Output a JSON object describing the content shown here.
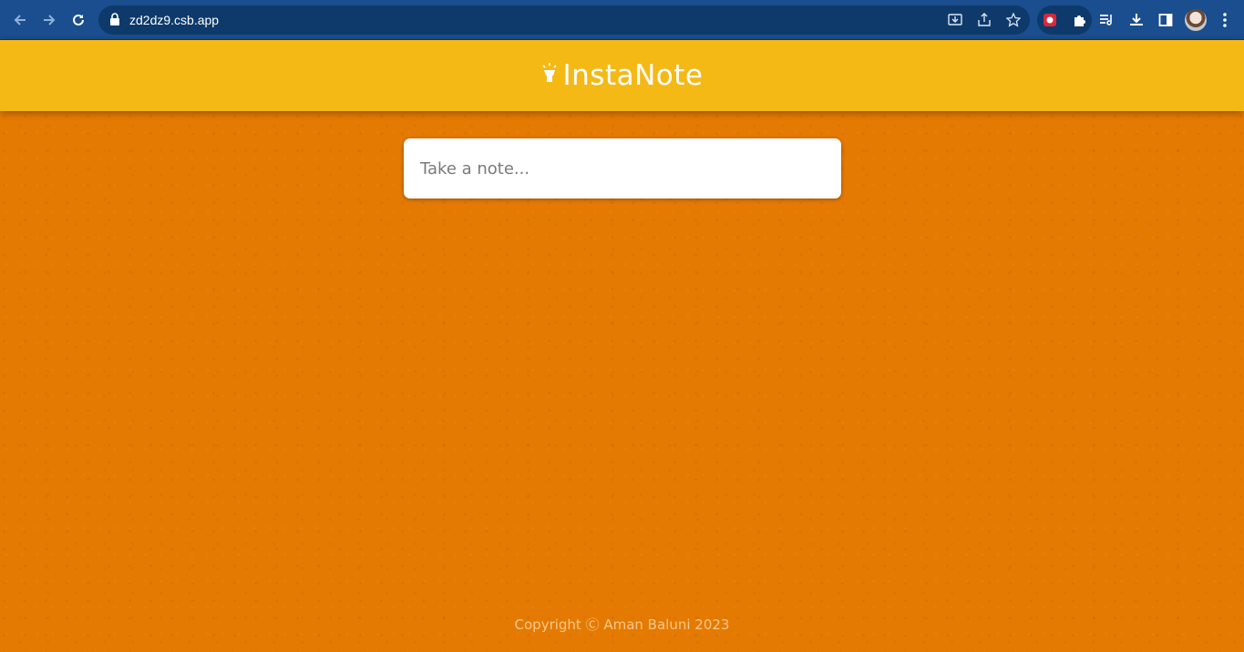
{
  "browser": {
    "url": "zd2dz9.csb.app"
  },
  "app": {
    "title": "InstaNote",
    "note_placeholder": "Take a note...",
    "footer": "Copyright Ⓒ Aman Baluni 2023"
  },
  "colors": {
    "header": "#f5b916",
    "background": "#e57a03",
    "chrome": "#1a4e8e"
  }
}
